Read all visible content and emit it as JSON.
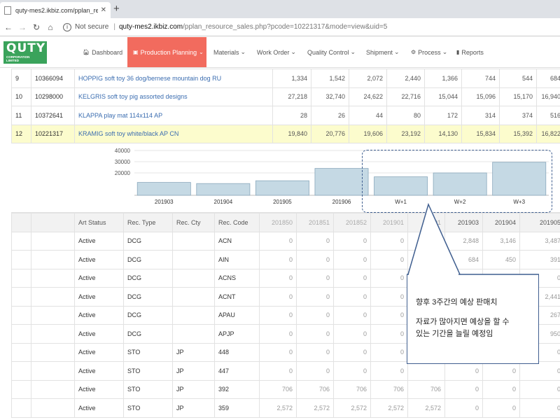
{
  "browser": {
    "tab_title": "quty-mes2.ikbiz.com/pplan_res",
    "security": "Not secure",
    "url_host": "quty-mes2.ikbiz.com",
    "url_path": "/pplan_resource_sales.php?pcode=10221317&mode=view&uid=5"
  },
  "logo": {
    "brand": "QUTY",
    "sub1": "CORPORATION",
    "sub2": "LIMITED",
    "color": "#3aa35b"
  },
  "nav": {
    "dashboard": "Dashboard",
    "production_planning": "Production Planning",
    "materials": "Materials",
    "work_order": "Work Order",
    "quality_control": "Quality Control",
    "shipment": "Shipment",
    "process": "Process",
    "reports": "Reports",
    "active_color": "#f26b5e"
  },
  "product_rows": [
    {
      "no": "9",
      "code": "10366094",
      "name": "HOPPIG soft toy 36 dog/bernese mountain dog RU",
      "vals": [
        "1,334",
        "1,542",
        "2,072",
        "2,440",
        "1,366",
        "744",
        "544",
        "684"
      ]
    },
    {
      "no": "10",
      "code": "10298000",
      "name": "KELGRIS soft toy pig assorted designs",
      "vals": [
        "27,218",
        "32,740",
        "24,622",
        "22,716",
        "15,044",
        "15,096",
        "15,170",
        "16,940"
      ]
    },
    {
      "no": "11",
      "code": "10372641",
      "name": "KLAPPA play mat 114x114 AP",
      "vals": [
        "28",
        "26",
        "44",
        "80",
        "172",
        "314",
        "374",
        "516"
      ]
    },
    {
      "no": "12",
      "code": "10221317",
      "name": "KRAMIG soft toy white/black AP CN",
      "vals": [
        "19,840",
        "20,776",
        "19,606",
        "23,192",
        "14,130",
        "15,834",
        "15,392",
        "16,822"
      ]
    }
  ],
  "chart_data": {
    "type": "bar",
    "categories": [
      "201903",
      "201904",
      "201905",
      "201906",
      "W+1",
      "W+2",
      "W+3"
    ],
    "values": [
      11500,
      10500,
      13000,
      24000,
      16500,
      20000,
      29500
    ],
    "ylim": [
      0,
      40000
    ],
    "yticks": [
      "40000",
      "30000",
      "20000"
    ],
    "bar_color": "#c5d9e4",
    "bar_stroke": "#8aa8bc"
  },
  "detail": {
    "headers": [
      "Art Status",
      "Rec. Type",
      "Rec. Cty",
      "Rec. Code",
      "201850",
      "201851",
      "201852",
      "201901",
      "201",
      "201903",
      "201904",
      "201905"
    ],
    "rows": [
      {
        "status": "Active",
        "type": "DCG",
        "cty": "",
        "code": "ACN",
        "vals": [
          "0",
          "0",
          "0",
          "0",
          "",
          "2,848",
          "3,146",
          "3,487"
        ]
      },
      {
        "status": "Active",
        "type": "DCG",
        "cty": "",
        "code": "AIN",
        "vals": [
          "0",
          "0",
          "0",
          "0",
          "",
          "684",
          "450",
          "391"
        ]
      },
      {
        "status": "Active",
        "type": "DCG",
        "cty": "",
        "code": "ACNS",
        "vals": [
          "0",
          "0",
          "0",
          "0",
          "",
          "",
          "",
          "0"
        ]
      },
      {
        "status": "Active",
        "type": "DCG",
        "cty": "",
        "code": "ACNT",
        "vals": [
          "0",
          "0",
          "0",
          "0",
          "",
          "",
          "",
          "2,441"
        ]
      },
      {
        "status": "Active",
        "type": "DCG",
        "cty": "",
        "code": "APAU",
        "vals": [
          "0",
          "0",
          "0",
          "0",
          "",
          "",
          "",
          "267"
        ]
      },
      {
        "status": "Active",
        "type": "DCG",
        "cty": "",
        "code": "APJP",
        "vals": [
          "0",
          "0",
          "0",
          "0",
          "",
          "",
          "",
          "950"
        ]
      },
      {
        "status": "Active",
        "type": "STO",
        "cty": "JP",
        "code": "448",
        "vals": [
          "0",
          "0",
          "0",
          "0",
          "",
          "",
          "",
          "0"
        ]
      },
      {
        "status": "Active",
        "type": "STO",
        "cty": "JP",
        "code": "447",
        "vals": [
          "0",
          "0",
          "0",
          "0",
          "",
          "0",
          "0",
          "0"
        ]
      },
      {
        "status": "Active",
        "type": "STO",
        "cty": "JP",
        "code": "392",
        "vals": [
          "706",
          "706",
          "706",
          "706",
          "706",
          "0",
          "0",
          "0"
        ]
      },
      {
        "status": "Active",
        "type": "STO",
        "cty": "JP",
        "code": "359",
        "vals": [
          "2,572",
          "2,572",
          "2,572",
          "2,572",
          "2,572",
          "0",
          "0",
          "0"
        ]
      }
    ]
  },
  "callout": {
    "line1": "향후 3주간의 예상 판매치",
    "line2": "자료가 많아지면 예상을 할 수",
    "line3": "있는 기간을 늘릴 예정임",
    "border_color": "#3f5e8f"
  }
}
